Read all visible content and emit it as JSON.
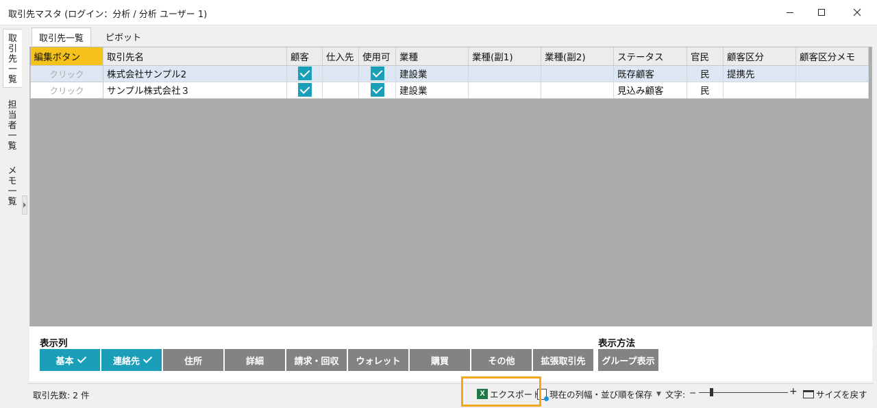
{
  "window": {
    "title": "取引先マスタ (ログイン：分析 / 分析 ユーザー 1)"
  },
  "side_tabs": [
    {
      "label": "取引先一覧",
      "chars": [
        "取",
        "引",
        "先",
        "一",
        "覧"
      ],
      "active": true
    },
    {
      "label": "担当者一覧",
      "chars": [
        "担",
        "当",
        "者",
        "一",
        "覧"
      ],
      "active": false
    },
    {
      "label": "メモ一覧",
      "chars": [
        "メ",
        "モ",
        "一",
        "覧"
      ],
      "active": false
    }
  ],
  "top_tabs": [
    {
      "label": "取引先一覧",
      "active": true
    },
    {
      "label": "ピボット",
      "active": false
    }
  ],
  "grid": {
    "columns": [
      "編集ボタン",
      "取引先名",
      "顧客",
      "仕入先",
      "使用可",
      "業種",
      "業種(副1)",
      "業種(副2)",
      "ステータス",
      "官民",
      "顧客区分",
      "顧客区分メモ"
    ],
    "rows": [
      {
        "edit": "クリック",
        "name": "株式会社サンプル2",
        "customer": true,
        "supplier": false,
        "usable": true,
        "industry": "建設業",
        "sub1": "",
        "sub2": "",
        "status": "既存顧客",
        "public_private": "民",
        "category": "提携先",
        "category_memo": "",
        "selected": true
      },
      {
        "edit": "クリック",
        "name": "サンプル株式会社３",
        "customer": true,
        "supplier": false,
        "usable": true,
        "industry": "建設業",
        "sub1": "",
        "sub2": "",
        "status": "見込み顧客",
        "public_private": "民",
        "category": "",
        "category_memo": "",
        "selected": false
      }
    ]
  },
  "display_columns": {
    "label": "表示列",
    "buttons": [
      {
        "label": "基本",
        "on": true
      },
      {
        "label": "連絡先",
        "on": true
      },
      {
        "label": "住所",
        "on": false
      },
      {
        "label": "詳細",
        "on": false
      },
      {
        "label": "請求・回収",
        "on": false
      },
      {
        "label": "ウォレット",
        "on": false
      },
      {
        "label": "購買",
        "on": false
      },
      {
        "label": "その他",
        "on": false
      },
      {
        "label": "拡張取引先",
        "on": false
      }
    ]
  },
  "display_method": {
    "label": "表示方法",
    "button": "グループ表示"
  },
  "statusbar": {
    "count": "取引先数: 2 件",
    "export": "エクスポート",
    "save_layout": "現在の列幅・並び順を保存",
    "font_label": "文字:",
    "reset_size": "サイズを戻す"
  },
  "colors": {
    "accent": "#1b9fb8",
    "header_highlight": "#f5c21b",
    "export_highlight": "#f4a61a",
    "excel_green": "#1e7a45"
  }
}
